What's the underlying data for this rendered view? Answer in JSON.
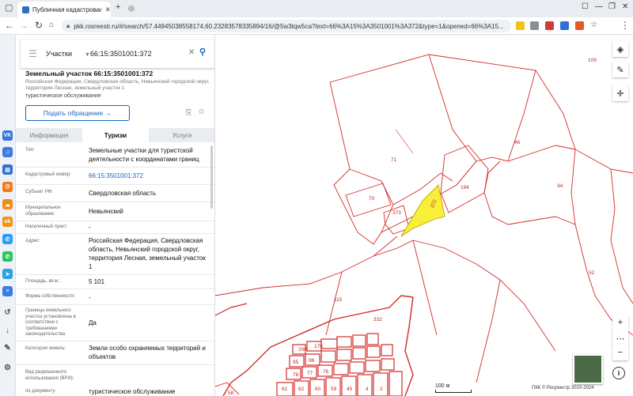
{
  "browser": {
    "tab_title": "Публичная кадастровая ка",
    "url": "pkk.rosreestr.ru/#/search/57.44945038558174,60.23283578335894/16/@5w3tqw5ca?text=66%3A15%3A3501001%3A372&type=1&opened=66%3A15..."
  },
  "search": {
    "layer": "Участки",
    "query": "66:15:3501001:372"
  },
  "parcel": {
    "title": "Земельный участок 66:15:3501001:372",
    "address_short": "Российская Федерация, Свердловская область, Невьянский городской округ, территория Лесная, земельный участок 1",
    "use": "туристическое обслуживание",
    "appeal_label": "Подать обращение →"
  },
  "tabs": [
    "Информация",
    "Туризм",
    "Услуги"
  ],
  "rows": [
    {
      "label": "Тип:",
      "value": "Земельные участки для туристской деятельности с координатами границ"
    },
    {
      "label": "Кадастровый номер:",
      "value": "66:15:3501001:372"
    },
    {
      "label": "Субъект РФ:",
      "value": "Свердловская область"
    },
    {
      "label": "Муниципальное образование:",
      "value": "Невьянский"
    },
    {
      "label": "Населенный пункт:",
      "value": "-"
    },
    {
      "label": "Адрес:",
      "value": "Российская Федерация, Свердловская область, Невьянский городской округ, территория Лесная, земельный участок 1"
    },
    {
      "label": "Площадь, кв.м.:",
      "value": "5 101"
    },
    {
      "label": "Форма собственности:",
      "value": "-"
    },
    {
      "label": "Границы земельного участка установлены в соответствии с требованиями законодательства:",
      "value": "Да"
    },
    {
      "label": "Категория земель:",
      "value": "Земли особо охраняемых территорий и объектов"
    },
    {
      "label": "Вид разрешенного использования (ВРИ):",
      "value": ""
    },
    {
      "label": "по документу:",
      "value": "туристическое обслуживание"
    }
  ],
  "map": {
    "parcel_labels": [
      "109",
      "46",
      "71",
      "194",
      "34",
      "70",
      "373",
      "372",
      "52",
      "115",
      "332",
      "58",
      "200",
      "176",
      "95",
      "96",
      "78",
      "77",
      "76",
      "61",
      "62",
      "60",
      "59",
      "45",
      "4",
      "2"
    ],
    "scale_label": "100 м",
    "copyright": "ПКК © Росреестр 2010-2024",
    "colors": {
      "boundary": "#d42a2a",
      "selected_fill": "#f7ef3a"
    }
  },
  "icons": {
    "sidebar": [
      "vk-icon",
      "music-icon",
      "stats-icon",
      "mail-icon",
      "cloud-icon",
      "ok-icon",
      "phone-icon",
      "whatsapp-icon",
      "telegram-icon",
      "list-icon",
      "history-icon",
      "download-icon",
      "settings-icon"
    ]
  }
}
